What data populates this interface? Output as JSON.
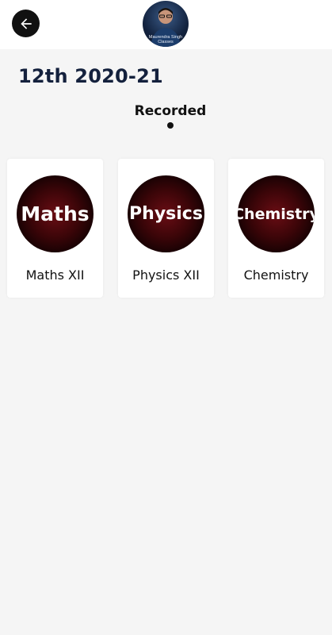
{
  "header": {
    "avatar_caption": "Maurendra Singh Classes"
  },
  "page": {
    "title": "12th 2020-21"
  },
  "tabs": [
    {
      "label": "Recorded",
      "active": true
    }
  ],
  "courses": [
    {
      "thumb_text": "Maths",
      "label": "Maths XII"
    },
    {
      "thumb_text": "Physics",
      "label": "Physics XII"
    },
    {
      "thumb_text": "Chemistry",
      "label": "Chemistry"
    }
  ],
  "colors": {
    "title": "#14213d",
    "background": "#f5f5f5",
    "thumb_center": "#6a0d14"
  },
  "icons": {
    "back": "arrow-left-icon"
  }
}
